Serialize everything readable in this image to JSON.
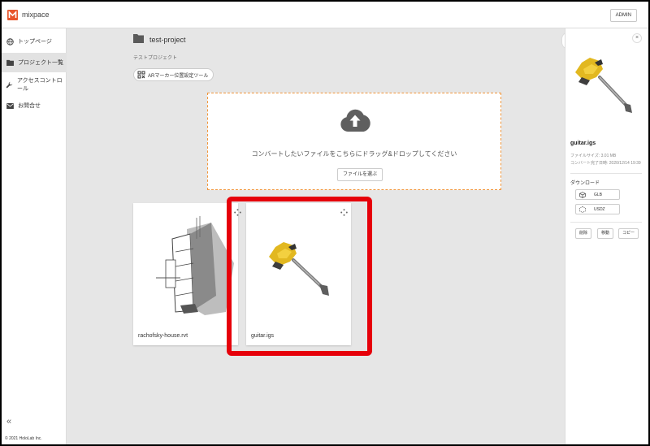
{
  "header": {
    "app_title": "mixpace",
    "admin_label": "ADMIN"
  },
  "sidebar": {
    "items": [
      {
        "label": "トップページ",
        "icon": "globe-icon",
        "active": false
      },
      {
        "label": "プロジェクト一覧",
        "icon": "folder-icon",
        "active": true
      },
      {
        "label": "アクセスコントロール",
        "icon": "wrench-icon",
        "active": false
      },
      {
        "label": "お問合せ",
        "icon": "mail-icon",
        "active": false
      }
    ],
    "collapse_label": "«",
    "copyright": "© 2021 HoloLab Inc."
  },
  "project": {
    "title": "test-project",
    "subtitle": "テストプロジェクト",
    "ar_tool_label": "ARマーカー位置設定ツール"
  },
  "dropzone": {
    "text": "コンバートしたいファイルをこちらにドラッグ&ドロップしてください",
    "select_label": "ファイルを選ぶ"
  },
  "files": [
    {
      "name": "rachofsky-house.rvt"
    },
    {
      "name": "guitar.igs"
    }
  ],
  "details": {
    "close_label": "×",
    "file_name": "guitar.igs",
    "file_size": "ファイルサイズ: 3.01 MB",
    "converted_at": "コンバート完了日時: 2020/12/14 19:39",
    "download_label": "ダウンロード",
    "formats": [
      "GLB",
      "USDZ"
    ],
    "actions": [
      "削除",
      "移動",
      "コピー"
    ]
  },
  "colors": {
    "accent": "#e6000a",
    "dropzone_border": "#f0963c",
    "logo": "#e8552b"
  }
}
